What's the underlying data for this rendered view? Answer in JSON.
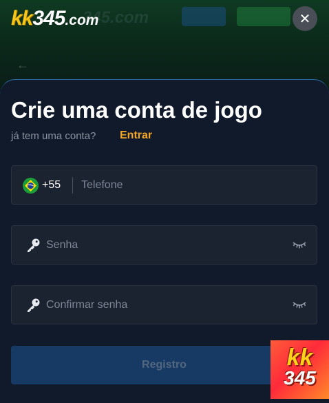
{
  "header": {
    "logo_kk": "kk",
    "logo_num": "345",
    "logo_dom": ".com",
    "close_glyph": "✕",
    "back_glyph": "←"
  },
  "form": {
    "title": "Crie uma conta de jogo",
    "subtitle": "já tem uma conta?",
    "login_link": "Entrar",
    "phone": {
      "country_code": "+55",
      "placeholder": "Telefone",
      "flag_icon": "brazil-flag-icon"
    },
    "password": {
      "placeholder": "Senha",
      "icon": "key-icon",
      "toggle_icon": "eye-closed-icon"
    },
    "confirm_password": {
      "placeholder": "Confirmar senha",
      "icon": "key-icon",
      "toggle_icon": "eye-closed-icon"
    },
    "register_label": "Registro"
  },
  "badge": {
    "line1": "kk",
    "line2": "345"
  },
  "colors": {
    "accent_orange": "#f5a623",
    "modal_bg": "#111a2a",
    "field_bg": "#1b2230",
    "button_disabled": "#173a64"
  }
}
